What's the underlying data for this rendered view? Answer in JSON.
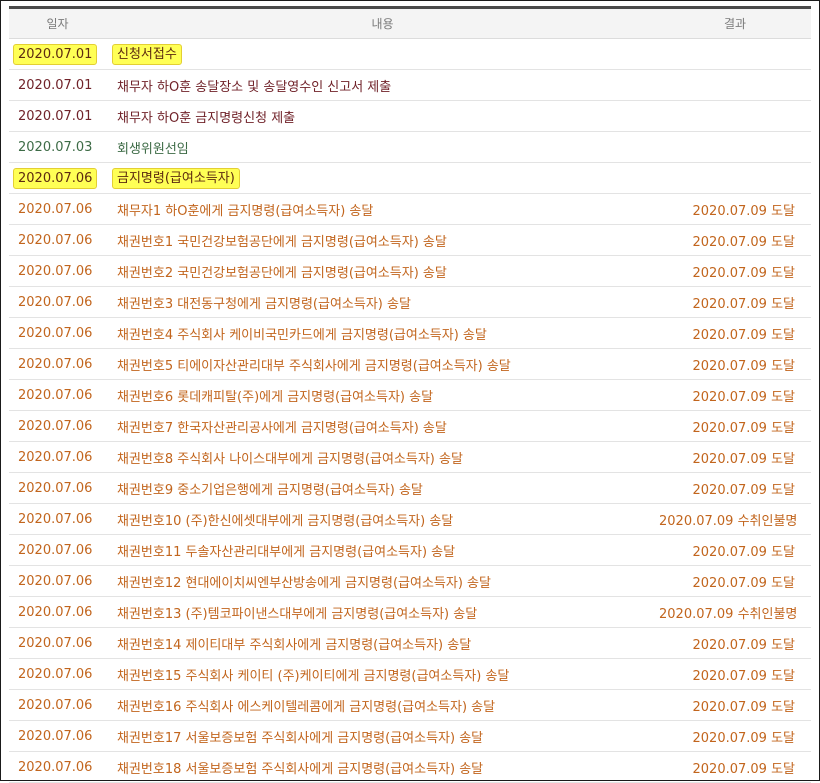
{
  "headers": {
    "date": "일자",
    "content": "내용",
    "result": "결과"
  },
  "colors": {
    "maroon": "#702229",
    "green": "#3d6b46",
    "orange": "#c2651d",
    "highlight": "#ffff55"
  },
  "rows": [
    {
      "date": "2020.07.01",
      "content": "신청서접수",
      "result": "",
      "tone": "hl"
    },
    {
      "date": "2020.07.01",
      "content": "채무자 하O훈 송달장소 및 송달영수인 신고서 제출",
      "result": "",
      "tone": "maroon"
    },
    {
      "date": "2020.07.01",
      "content": "채무자 하O훈 금지명령신청 제출",
      "result": "",
      "tone": "maroon"
    },
    {
      "date": "2020.07.03",
      "content": "회생위원선임",
      "result": "",
      "tone": "green"
    },
    {
      "date": "2020.07.06",
      "content": "금지명령(급여소득자)",
      "result": "",
      "tone": "hl"
    },
    {
      "date": "2020.07.06",
      "content": "채무자1 하O훈에게 금지명령(급여소득자) 송달",
      "result": "2020.07.09 도달",
      "tone": "orange"
    },
    {
      "date": "2020.07.06",
      "content": "채권번호1 국민건강보험공단에게 금지명령(급여소득자) 송달",
      "result": "2020.07.09 도달",
      "tone": "orange"
    },
    {
      "date": "2020.07.06",
      "content": "채권번호2 국민건강보험공단에게 금지명령(급여소득자) 송달",
      "result": "2020.07.09 도달",
      "tone": "orange"
    },
    {
      "date": "2020.07.06",
      "content": "채권번호3 대전동구청에게 금지명령(급여소득자) 송달",
      "result": "2020.07.09 도달",
      "tone": "orange"
    },
    {
      "date": "2020.07.06",
      "content": "채권번호4 주식회사 케이비국민카드에게 금지명령(급여소득자) 송달",
      "result": "2020.07.09 도달",
      "tone": "orange"
    },
    {
      "date": "2020.07.06",
      "content": "채권번호5 티에이자산관리대부 주식회사에게 금지명령(급여소득자) 송달",
      "result": "2020.07.09 도달",
      "tone": "orange"
    },
    {
      "date": "2020.07.06",
      "content": "채권번호6 롯데캐피탈(주)에게 금지명령(급여소득자) 송달",
      "result": "2020.07.09 도달",
      "tone": "orange"
    },
    {
      "date": "2020.07.06",
      "content": "채권번호7 한국자산관리공사에게 금지명령(급여소득자) 송달",
      "result": "2020.07.09 도달",
      "tone": "orange"
    },
    {
      "date": "2020.07.06",
      "content": "채권번호8 주식회사 나이스대부에게 금지명령(급여소득자) 송달",
      "result": "2020.07.09 도달",
      "tone": "orange"
    },
    {
      "date": "2020.07.06",
      "content": "채권번호9 중소기업은행에게 금지명령(급여소득자) 송달",
      "result": "2020.07.09 도달",
      "tone": "orange"
    },
    {
      "date": "2020.07.06",
      "content": "채권번호10 (주)한신에셋대부에게 금지명령(급여소득자) 송달",
      "result": "2020.07.09 수취인불명",
      "tone": "orange"
    },
    {
      "date": "2020.07.06",
      "content": "채권번호11 두솔자산관리대부에게 금지명령(급여소득자) 송달",
      "result": "2020.07.09 도달",
      "tone": "orange"
    },
    {
      "date": "2020.07.06",
      "content": "채권번호12 현대에이치씨엔부산방송에게 금지명령(급여소득자) 송달",
      "result": "2020.07.09 도달",
      "tone": "orange"
    },
    {
      "date": "2020.07.06",
      "content": "채권번호13 (주)템코파이낸스대부에게 금지명령(급여소득자) 송달",
      "result": "2020.07.09 수취인불명",
      "tone": "orange"
    },
    {
      "date": "2020.07.06",
      "content": "채권번호14 제이티대부 주식회사에게 금지명령(급여소득자) 송달",
      "result": "2020.07.09 도달",
      "tone": "orange"
    },
    {
      "date": "2020.07.06",
      "content": "채권번호15 주식회사 케이티 (주)케이티에게 금지명령(급여소득자) 송달",
      "result": "2020.07.09 도달",
      "tone": "orange"
    },
    {
      "date": "2020.07.06",
      "content": "채권번호16 주식회사 에스케이텔레콤에게 금지명령(급여소득자) 송달",
      "result": "2020.07.09 도달",
      "tone": "orange"
    },
    {
      "date": "2020.07.06",
      "content": "채권번호17 서울보증보험 주식회사에게 금지명령(급여소득자) 송달",
      "result": "2020.07.09 도달",
      "tone": "orange"
    },
    {
      "date": "2020.07.06",
      "content": "채권번호18 서울보증보험 주식회사에게 금지명령(급여소득자) 송달",
      "result": "2020.07.09 도달",
      "tone": "orange"
    }
  ]
}
